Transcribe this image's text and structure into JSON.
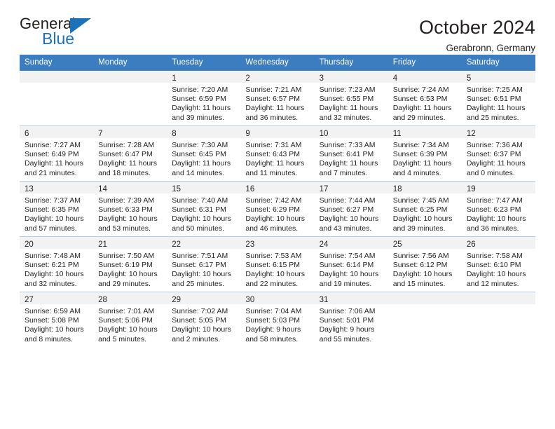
{
  "brand": {
    "name_part1": "General",
    "name_part2": "Blue",
    "accent_color": "#1c72b8",
    "triangle_icon": "brand-triangle-icon"
  },
  "header": {
    "title": "October 2024",
    "subtitle": "Gerabronn, Germany"
  },
  "theme": {
    "header_row_bg": "#3b7dbe",
    "header_row_text": "#ffffff",
    "daynum_band_bg": "#f2f2f2",
    "row_divider": "#b9cde0",
    "body_text": "#231f20"
  },
  "calendar": {
    "weekday_headers": [
      "Sunday",
      "Monday",
      "Tuesday",
      "Wednesday",
      "Thursday",
      "Friday",
      "Saturday"
    ],
    "weeks": [
      [
        {
          "day": "",
          "sunrise": "",
          "sunset": "",
          "daylight_line1": "",
          "daylight_line2": "",
          "empty": true
        },
        {
          "day": "",
          "sunrise": "",
          "sunset": "",
          "daylight_line1": "",
          "daylight_line2": "",
          "empty": true
        },
        {
          "day": "1",
          "sunrise": "Sunrise: 7:20 AM",
          "sunset": "Sunset: 6:59 PM",
          "daylight_line1": "Daylight: 11 hours",
          "daylight_line2": "and 39 minutes."
        },
        {
          "day": "2",
          "sunrise": "Sunrise: 7:21 AM",
          "sunset": "Sunset: 6:57 PM",
          "daylight_line1": "Daylight: 11 hours",
          "daylight_line2": "and 36 minutes."
        },
        {
          "day": "3",
          "sunrise": "Sunrise: 7:23 AM",
          "sunset": "Sunset: 6:55 PM",
          "daylight_line1": "Daylight: 11 hours",
          "daylight_line2": "and 32 minutes."
        },
        {
          "day": "4",
          "sunrise": "Sunrise: 7:24 AM",
          "sunset": "Sunset: 6:53 PM",
          "daylight_line1": "Daylight: 11 hours",
          "daylight_line2": "and 29 minutes."
        },
        {
          "day": "5",
          "sunrise": "Sunrise: 7:25 AM",
          "sunset": "Sunset: 6:51 PM",
          "daylight_line1": "Daylight: 11 hours",
          "daylight_line2": "and 25 minutes."
        }
      ],
      [
        {
          "day": "6",
          "sunrise": "Sunrise: 7:27 AM",
          "sunset": "Sunset: 6:49 PM",
          "daylight_line1": "Daylight: 11 hours",
          "daylight_line2": "and 21 minutes."
        },
        {
          "day": "7",
          "sunrise": "Sunrise: 7:28 AM",
          "sunset": "Sunset: 6:47 PM",
          "daylight_line1": "Daylight: 11 hours",
          "daylight_line2": "and 18 minutes."
        },
        {
          "day": "8",
          "sunrise": "Sunrise: 7:30 AM",
          "sunset": "Sunset: 6:45 PM",
          "daylight_line1": "Daylight: 11 hours",
          "daylight_line2": "and 14 minutes."
        },
        {
          "day": "9",
          "sunrise": "Sunrise: 7:31 AM",
          "sunset": "Sunset: 6:43 PM",
          "daylight_line1": "Daylight: 11 hours",
          "daylight_line2": "and 11 minutes."
        },
        {
          "day": "10",
          "sunrise": "Sunrise: 7:33 AM",
          "sunset": "Sunset: 6:41 PM",
          "daylight_line1": "Daylight: 11 hours",
          "daylight_line2": "and 7 minutes."
        },
        {
          "day": "11",
          "sunrise": "Sunrise: 7:34 AM",
          "sunset": "Sunset: 6:39 PM",
          "daylight_line1": "Daylight: 11 hours",
          "daylight_line2": "and 4 minutes."
        },
        {
          "day": "12",
          "sunrise": "Sunrise: 7:36 AM",
          "sunset": "Sunset: 6:37 PM",
          "daylight_line1": "Daylight: 11 hours",
          "daylight_line2": "and 0 minutes."
        }
      ],
      [
        {
          "day": "13",
          "sunrise": "Sunrise: 7:37 AM",
          "sunset": "Sunset: 6:35 PM",
          "daylight_line1": "Daylight: 10 hours",
          "daylight_line2": "and 57 minutes."
        },
        {
          "day": "14",
          "sunrise": "Sunrise: 7:39 AM",
          "sunset": "Sunset: 6:33 PM",
          "daylight_line1": "Daylight: 10 hours",
          "daylight_line2": "and 53 minutes."
        },
        {
          "day": "15",
          "sunrise": "Sunrise: 7:40 AM",
          "sunset": "Sunset: 6:31 PM",
          "daylight_line1": "Daylight: 10 hours",
          "daylight_line2": "and 50 minutes."
        },
        {
          "day": "16",
          "sunrise": "Sunrise: 7:42 AM",
          "sunset": "Sunset: 6:29 PM",
          "daylight_line1": "Daylight: 10 hours",
          "daylight_line2": "and 46 minutes."
        },
        {
          "day": "17",
          "sunrise": "Sunrise: 7:44 AM",
          "sunset": "Sunset: 6:27 PM",
          "daylight_line1": "Daylight: 10 hours",
          "daylight_line2": "and 43 minutes."
        },
        {
          "day": "18",
          "sunrise": "Sunrise: 7:45 AM",
          "sunset": "Sunset: 6:25 PM",
          "daylight_line1": "Daylight: 10 hours",
          "daylight_line2": "and 39 minutes."
        },
        {
          "day": "19",
          "sunrise": "Sunrise: 7:47 AM",
          "sunset": "Sunset: 6:23 PM",
          "daylight_line1": "Daylight: 10 hours",
          "daylight_line2": "and 36 minutes."
        }
      ],
      [
        {
          "day": "20",
          "sunrise": "Sunrise: 7:48 AM",
          "sunset": "Sunset: 6:21 PM",
          "daylight_line1": "Daylight: 10 hours",
          "daylight_line2": "and 32 minutes."
        },
        {
          "day": "21",
          "sunrise": "Sunrise: 7:50 AM",
          "sunset": "Sunset: 6:19 PM",
          "daylight_line1": "Daylight: 10 hours",
          "daylight_line2": "and 29 minutes."
        },
        {
          "day": "22",
          "sunrise": "Sunrise: 7:51 AM",
          "sunset": "Sunset: 6:17 PM",
          "daylight_line1": "Daylight: 10 hours",
          "daylight_line2": "and 25 minutes."
        },
        {
          "day": "23",
          "sunrise": "Sunrise: 7:53 AM",
          "sunset": "Sunset: 6:15 PM",
          "daylight_line1": "Daylight: 10 hours",
          "daylight_line2": "and 22 minutes."
        },
        {
          "day": "24",
          "sunrise": "Sunrise: 7:54 AM",
          "sunset": "Sunset: 6:14 PM",
          "daylight_line1": "Daylight: 10 hours",
          "daylight_line2": "and 19 minutes."
        },
        {
          "day": "25",
          "sunrise": "Sunrise: 7:56 AM",
          "sunset": "Sunset: 6:12 PM",
          "daylight_line1": "Daylight: 10 hours",
          "daylight_line2": "and 15 minutes."
        },
        {
          "day": "26",
          "sunrise": "Sunrise: 7:58 AM",
          "sunset": "Sunset: 6:10 PM",
          "daylight_line1": "Daylight: 10 hours",
          "daylight_line2": "and 12 minutes."
        }
      ],
      [
        {
          "day": "27",
          "sunrise": "Sunrise: 6:59 AM",
          "sunset": "Sunset: 5:08 PM",
          "daylight_line1": "Daylight: 10 hours",
          "daylight_line2": "and 8 minutes."
        },
        {
          "day": "28",
          "sunrise": "Sunrise: 7:01 AM",
          "sunset": "Sunset: 5:06 PM",
          "daylight_line1": "Daylight: 10 hours",
          "daylight_line2": "and 5 minutes."
        },
        {
          "day": "29",
          "sunrise": "Sunrise: 7:02 AM",
          "sunset": "Sunset: 5:05 PM",
          "daylight_line1": "Daylight: 10 hours",
          "daylight_line2": "and 2 minutes."
        },
        {
          "day": "30",
          "sunrise": "Sunrise: 7:04 AM",
          "sunset": "Sunset: 5:03 PM",
          "daylight_line1": "Daylight: 9 hours",
          "daylight_line2": "and 58 minutes."
        },
        {
          "day": "31",
          "sunrise": "Sunrise: 7:06 AM",
          "sunset": "Sunset: 5:01 PM",
          "daylight_line1": "Daylight: 9 hours",
          "daylight_line2": "and 55 minutes."
        },
        {
          "day": "",
          "sunrise": "",
          "sunset": "",
          "daylight_line1": "",
          "daylight_line2": "",
          "empty": true
        },
        {
          "day": "",
          "sunrise": "",
          "sunset": "",
          "daylight_line1": "",
          "daylight_line2": "",
          "empty": true
        }
      ]
    ]
  }
}
